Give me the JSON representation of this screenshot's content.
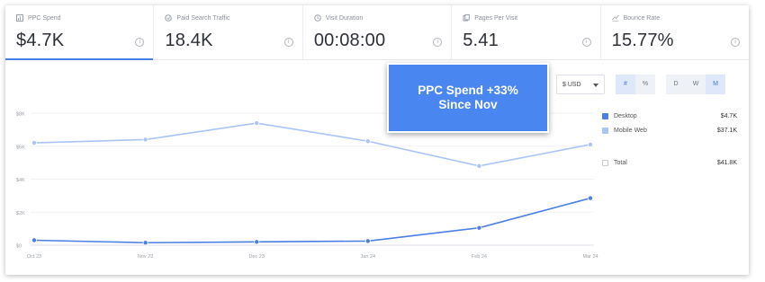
{
  "kpis": [
    {
      "label": "PPC Spend",
      "value": "$4.7K",
      "icon": "ppc-icon",
      "active": true
    },
    {
      "label": "Paid Search Traffic",
      "value": "18.4K",
      "icon": "traffic-icon",
      "active": false
    },
    {
      "label": "Visit Duration",
      "value": "00:08:00",
      "icon": "clock-icon",
      "active": false
    },
    {
      "label": "Pages Per Visit",
      "value": "5.41",
      "icon": "pages-icon",
      "active": false
    },
    {
      "label": "Bounce Rate",
      "value": "15.77%",
      "icon": "bounce-icon",
      "active": false
    }
  ],
  "info_glyph": "i",
  "callout": {
    "line1": "PPC Spend +33%",
    "line2": "Since Nov"
  },
  "controls": {
    "currency": "$ USD",
    "format_buttons": [
      "#",
      "%"
    ],
    "granularity_buttons": [
      "D",
      "W",
      "M"
    ],
    "active_granularity": "M",
    "active_format": "#"
  },
  "legend": {
    "items": [
      {
        "name": "Desktop",
        "value": "$4.7K",
        "color": "#4a7fe6",
        "checked": true
      },
      {
        "name": "Mobile Web",
        "value": "$37.1K",
        "color": "#a9c4f5",
        "checked": true
      }
    ],
    "total": {
      "name": "Total",
      "value": "$41.8K",
      "checked": false
    }
  },
  "chart_data": {
    "type": "line",
    "x": [
      "Oct 23",
      "Nov 23",
      "Dec 23",
      "Jan 24",
      "Feb 24",
      "Mar 24"
    ],
    "y_ticks": [
      "$0",
      "$2K",
      "$4K",
      "$6K",
      "$8K"
    ],
    "ylim": [
      0,
      8000
    ],
    "grid": true,
    "legend_position": "right",
    "series": [
      {
        "name": "Desktop",
        "color": "#4a7fe6",
        "values": [
          300,
          150,
          200,
          250,
          1050,
          2850
        ]
      },
      {
        "name": "Mobile Web",
        "color": "#a9c4f5",
        "values": [
          6200,
          6400,
          7400,
          6300,
          4800,
          6100
        ]
      }
    ]
  }
}
